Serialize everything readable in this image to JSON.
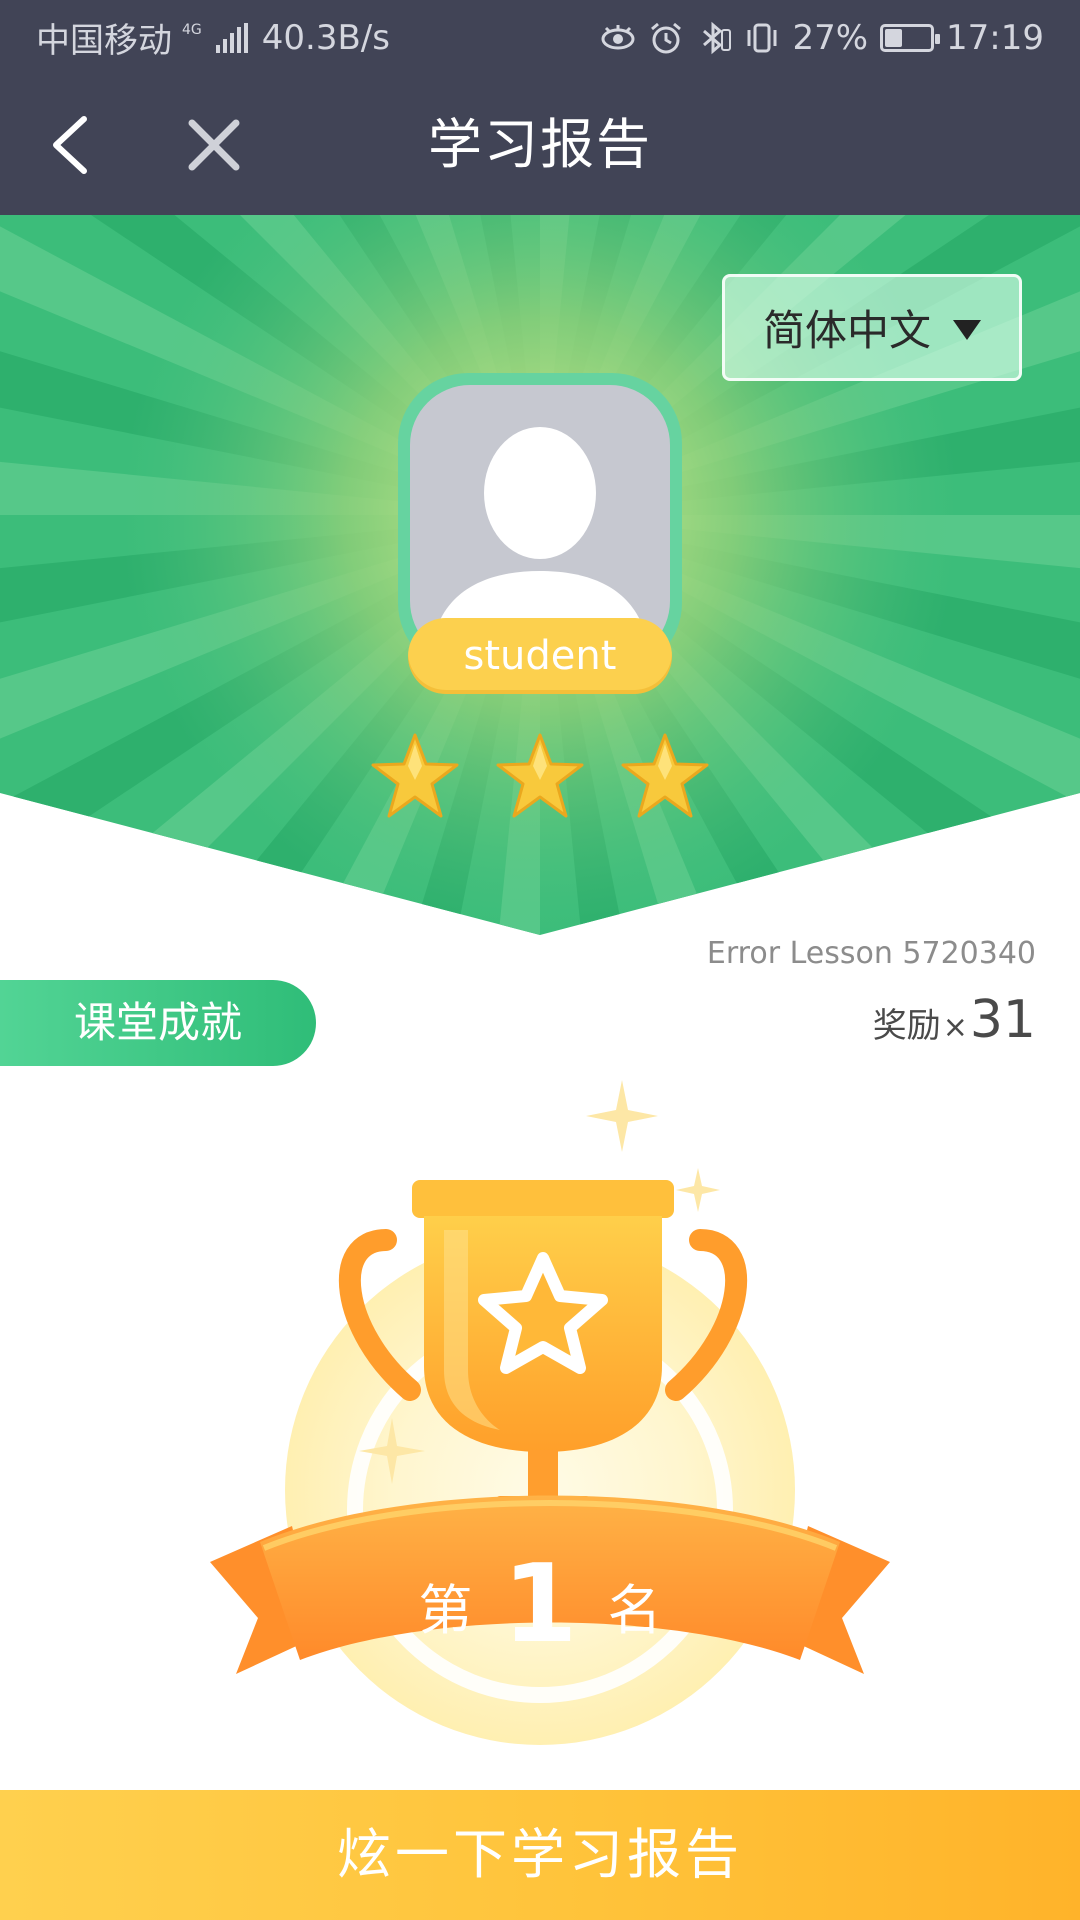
{
  "status_bar": {
    "carrier": "中国移动",
    "network": "4G",
    "speed": "40.3B/s",
    "battery": "27%",
    "time": "17:19",
    "icons": [
      "signal-icon",
      "eye-icon",
      "alarm-icon",
      "bluetooth-icon",
      "vibrate-icon",
      "battery-icon"
    ]
  },
  "nav": {
    "title": "学习报告",
    "back_icon": "chevron-left-icon",
    "close_icon": "close-icon"
  },
  "hero": {
    "language": "简体中文",
    "student_name": "student",
    "stars": 3,
    "colors": {
      "green": "#3dbf7c",
      "ray_dark": "#2eb06d",
      "ray_light": "#56c889",
      "glow": "#d4e88a"
    }
  },
  "lesson": {
    "text": "Error Lesson 5720340"
  },
  "achievement": {
    "tab_label": "课堂成就",
    "reward_label": "奖励",
    "reward_times": "×",
    "reward_count": "31"
  },
  "rank": {
    "prefix": "第",
    "number": "1",
    "suffix": "名"
  },
  "share_button": {
    "label": "炫一下学习报告"
  }
}
